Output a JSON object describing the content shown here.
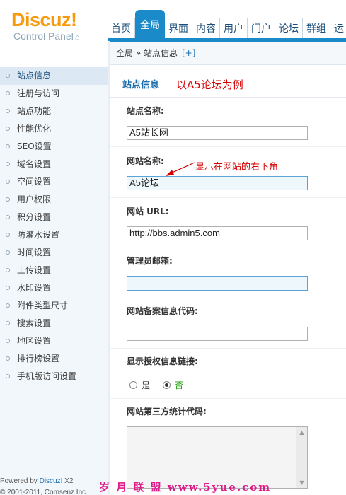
{
  "header": {
    "logo_main": "Discuz!",
    "logo_sub": "Control Panel",
    "nav": [
      "首页",
      "全局",
      "界面",
      "内容",
      "用户",
      "门户",
      "论坛",
      "群组",
      "运"
    ],
    "active_nav": "全局"
  },
  "breadcrumb": {
    "text": "全局 » 站点信息",
    "add_label": "[+]"
  },
  "sidebar": {
    "items": [
      "站点信息",
      "注册与访问",
      "站点功能",
      "性能优化",
      "SEO设置",
      "域名设置",
      "空间设置",
      "用户权限",
      "积分设置",
      "防灌水设置",
      "时间设置",
      "上传设置",
      "水印设置",
      "附件类型尺寸",
      "搜索设置",
      "地区设置",
      "排行榜设置",
      "手机版访问设置"
    ],
    "active": "站点信息",
    "footer_prefix": "Powered by ",
    "footer_brand": "Discuz!",
    "footer_version": " X2",
    "footer_copy": "© 2001-2011, Comsenz Inc."
  },
  "main": {
    "page_title": "站点信息",
    "annotation_title": "以A5论坛为例",
    "annotation_arrow": "显示在网站的右下角",
    "fields": {
      "site_name_label": "站点名称:",
      "site_name_value": "A5站长网",
      "web_name_label": "网站名称:",
      "web_name_value": "A5论坛",
      "url_label": "网站 URL:",
      "url_value": "http://bbs.admin5.com",
      "email_label": "管理员邮箱:",
      "email_value": "",
      "icp_label": "网站备案信息代码:",
      "icp_value": "",
      "license_label": "显示授权信息链接:",
      "license_yes": "是",
      "license_no": "否",
      "license_selected": "否",
      "stats_label": "网站第三方统计代码:"
    }
  },
  "watermark": "岁 月 联 盟  www.5yue.com",
  "colors": {
    "accent": "#1a8ac8",
    "logo": "#f79a0e",
    "annotation": "#d40000",
    "watermark": "#e0188a"
  }
}
